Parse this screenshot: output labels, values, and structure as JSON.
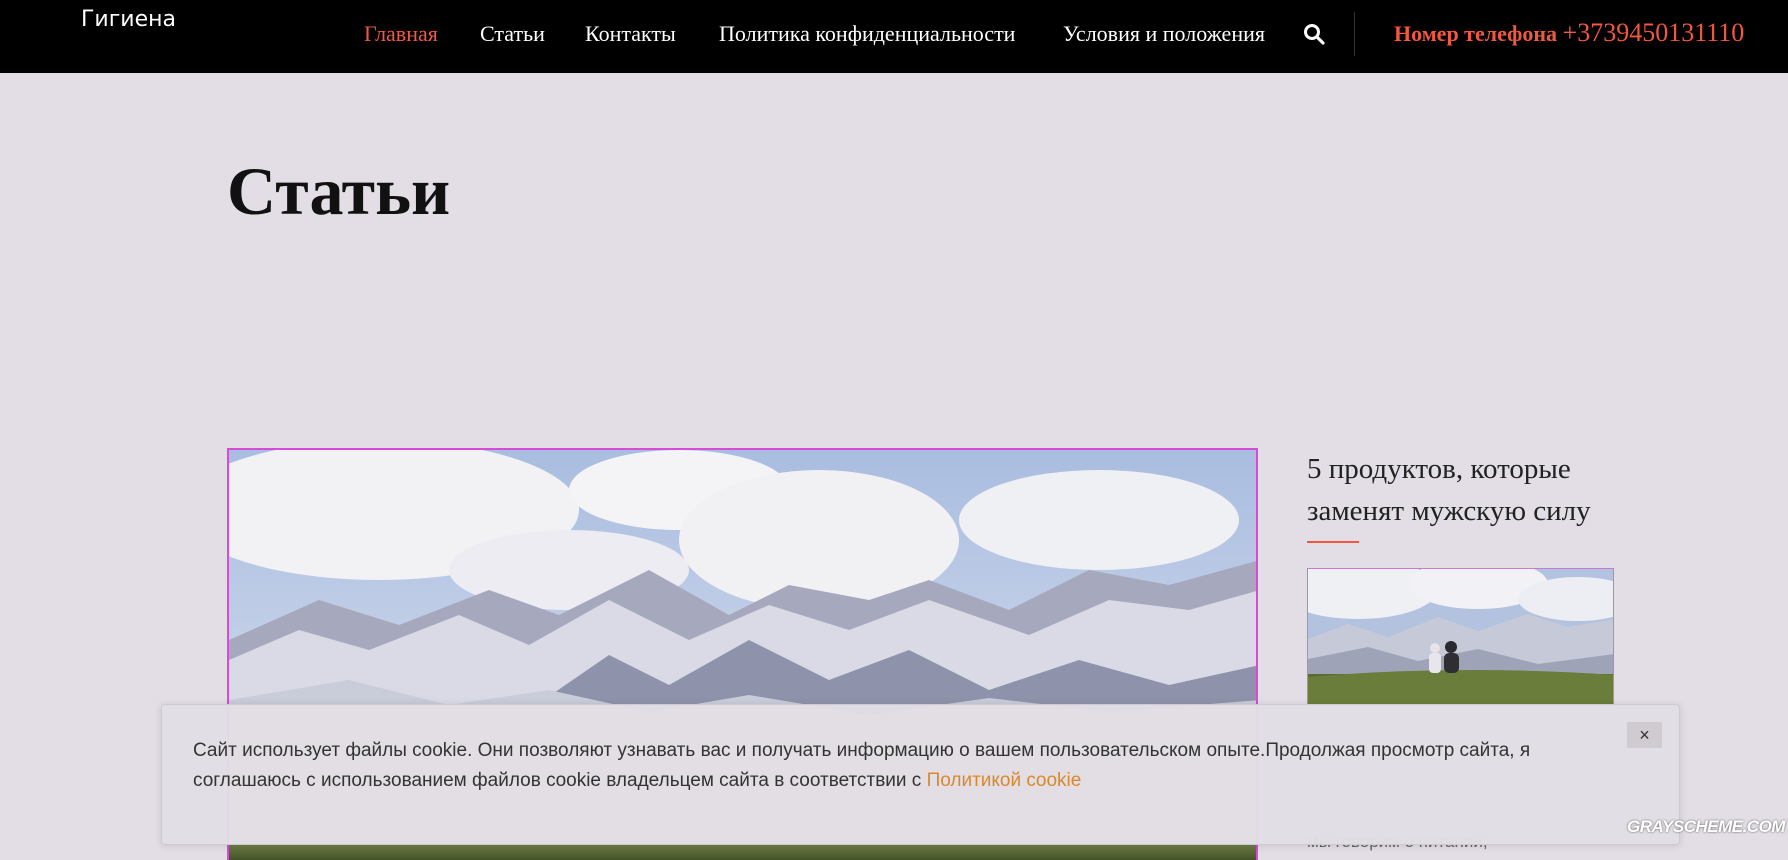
{
  "header": {
    "brand": "Гигиена",
    "nav": [
      {
        "label": "Главная",
        "active": true
      },
      {
        "label": "Статьи",
        "active": false
      },
      {
        "label": "Контакты",
        "active": false
      },
      {
        "label": "Политика конфиденциальности",
        "active": false
      },
      {
        "label": "Условия и положения",
        "active": false
      }
    ],
    "search_icon": "search-icon",
    "phone_label": "Номер телефона",
    "phone_number": "+3739450131110"
  },
  "page": {
    "title": "Статьи"
  },
  "sidebar": {
    "post_title": "5 продуктов, которые заменят мужскую силу",
    "excerpt": "мы говорим о питании,"
  },
  "cookie_banner": {
    "text": "Сайт использует файлы cookie. Они позволяют узнавать вас и получать информацию о вашем пользовательском опыте.Продолжая просмотр сайта, я соглашаюсь с использованием файлов cookie владельцем сайта в соответствии с ",
    "link_text": "Политикой cookie",
    "close_label": "×"
  },
  "watermark": "GRAYSCHEME.COM",
  "colors": {
    "accent": "#f0583f",
    "header_bg": "#000000",
    "page_bg": "#e3dee5",
    "cookie_link": "#d9892d"
  }
}
